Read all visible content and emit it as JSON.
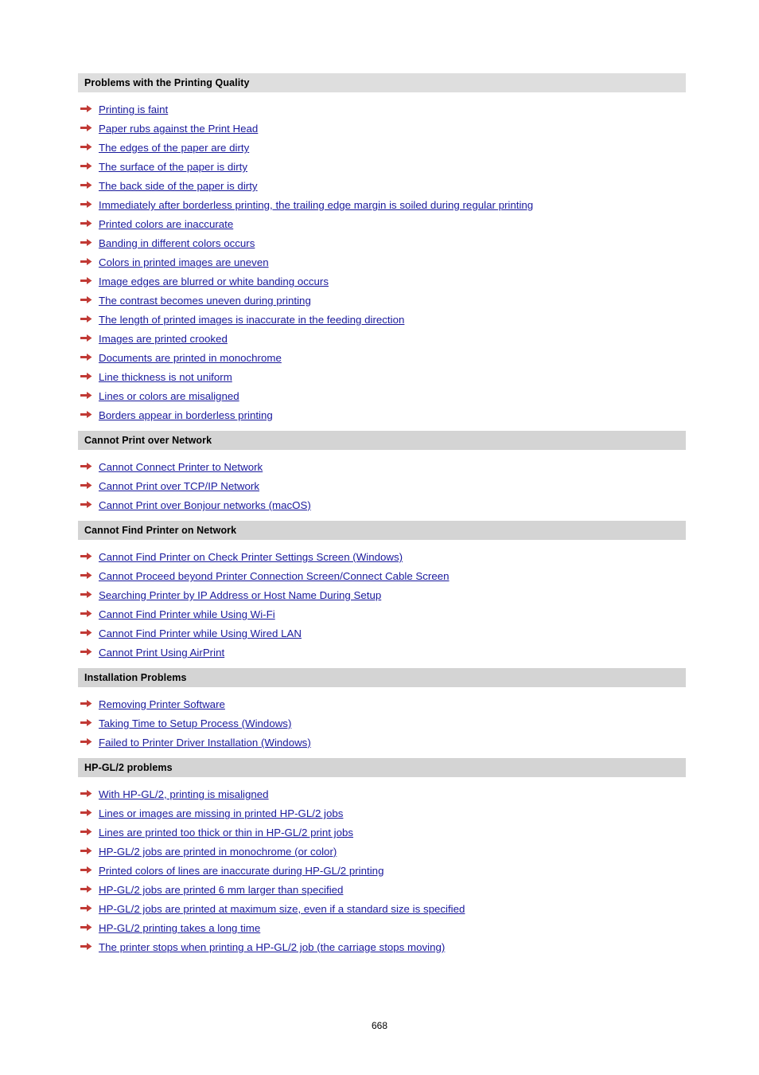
{
  "page": {
    "number": "668",
    "arrow_icon": "right-arrow-icon"
  },
  "sections": [
    {
      "title": "Problems with the Printing Quality",
      "links": [
        "Printing is faint",
        "Paper rubs against the Print Head",
        "The edges of the paper are dirty",
        "The surface of the paper is dirty",
        "The back side of the paper is dirty",
        "Immediately after borderless printing, the trailing edge margin is soiled during regular printing",
        "Printed colors are inaccurate",
        "Banding in different colors occurs",
        "Colors in printed images are uneven",
        "Image edges are blurred or white banding occurs",
        "The contrast becomes uneven during printing",
        "The length of printed images is inaccurate in the feeding direction",
        "Images are printed crooked",
        "Documents are printed in monochrome",
        "Line thickness is not uniform",
        "Lines or colors are misaligned",
        "Borders appear in borderless printing"
      ]
    },
    {
      "title": "Cannot Print over Network",
      "links": [
        "Cannot Connect Printer to Network",
        "Cannot Print over TCP/IP Network",
        "Cannot Print over Bonjour networks (macOS)"
      ]
    },
    {
      "title": "Cannot Find Printer on Network",
      "links": [
        "Cannot Find Printer on Check Printer Settings Screen (Windows)",
        "Cannot Proceed beyond Printer Connection Screen/Connect Cable Screen",
        "Searching Printer by IP Address or Host Name During Setup",
        "Cannot Find Printer while Using Wi-Fi",
        "Cannot Find Printer while Using Wired LAN",
        "Cannot Print Using AirPrint"
      ]
    },
    {
      "title": "Installation Problems",
      "links": [
        "Removing Printer Software",
        "Taking Time to Setup Process (Windows)",
        "Failed to Printer Driver Installation (Windows)"
      ]
    },
    {
      "title": "HP-GL/2 problems",
      "links": [
        "With HP-GL/2, printing is misaligned",
        "Lines or images are missing in printed HP-GL/2 jobs",
        "Lines are printed too thick or thin in HP-GL/2 print jobs",
        "HP-GL/2 jobs are printed in monochrome (or color)",
        "Printed colors of lines are inaccurate during HP-GL/2 printing",
        "HP-GL/2 jobs are printed 6 mm larger than specified",
        "HP-GL/2 jobs are printed at maximum size, even if a standard size is specified",
        "HP-GL/2 printing takes a long time",
        "The printer stops when printing a HP-GL/2 job (the carriage stops moving)"
      ]
    }
  ],
  "colors": {
    "link": "#1a1a9c",
    "arrow": "#c03030",
    "section_bg": "#dedede"
  }
}
